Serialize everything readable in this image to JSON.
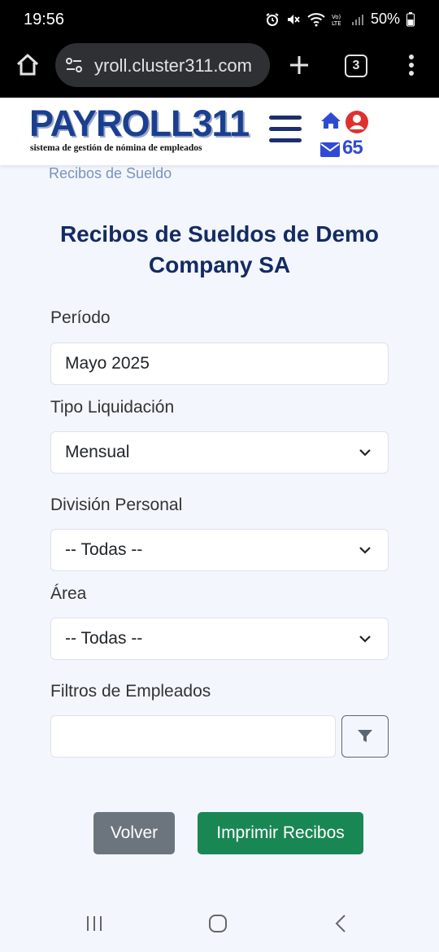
{
  "status_bar": {
    "time": "19:56",
    "battery": "50%",
    "icons": [
      "alarm-icon",
      "mute-icon",
      "wifi-icon",
      "volte-icon",
      "signal-icon",
      "battery-icon"
    ]
  },
  "browser": {
    "url": "yroll.cluster311.com",
    "tab_count": "3",
    "icons": [
      "home-icon",
      "site-settings-icon",
      "new-tab-icon",
      "tabs-icon",
      "more-icon"
    ]
  },
  "site_header": {
    "logo": "PAYROLL311",
    "logo_tagline": "sistema de gestión de nómina de empleados",
    "messages_count": "65",
    "icons": [
      "menu-icon",
      "house-icon",
      "user-icon",
      "mail-icon"
    ],
    "colors": {
      "brand": "#1b3f8f",
      "notification": "#e03131",
      "accent": "#2f4bd6"
    }
  },
  "breadcrumb": "Recibos de Sueldo",
  "page": {
    "title": "Recibos de Sueldos de Demo Company SA"
  },
  "form": {
    "periodo_label": "Período",
    "periodo_value": "Mayo 2025",
    "tipo_label": "Tipo Liquidación",
    "tipo_value": "Mensual",
    "division_label": "División Personal",
    "division_value": "-- Todas --",
    "area_label": "Área",
    "area_value": "-- Todas --",
    "filtros_label": "Filtros de Empleados",
    "filtros_value": ""
  },
  "actions": {
    "back": "Volver",
    "print": "Imprimir Recibos",
    "colors": {
      "back": "#6c757d",
      "print": "#198754"
    }
  },
  "nav": {
    "icons": [
      "recent-apps-icon",
      "home-circle-icon",
      "back-icon"
    ]
  }
}
